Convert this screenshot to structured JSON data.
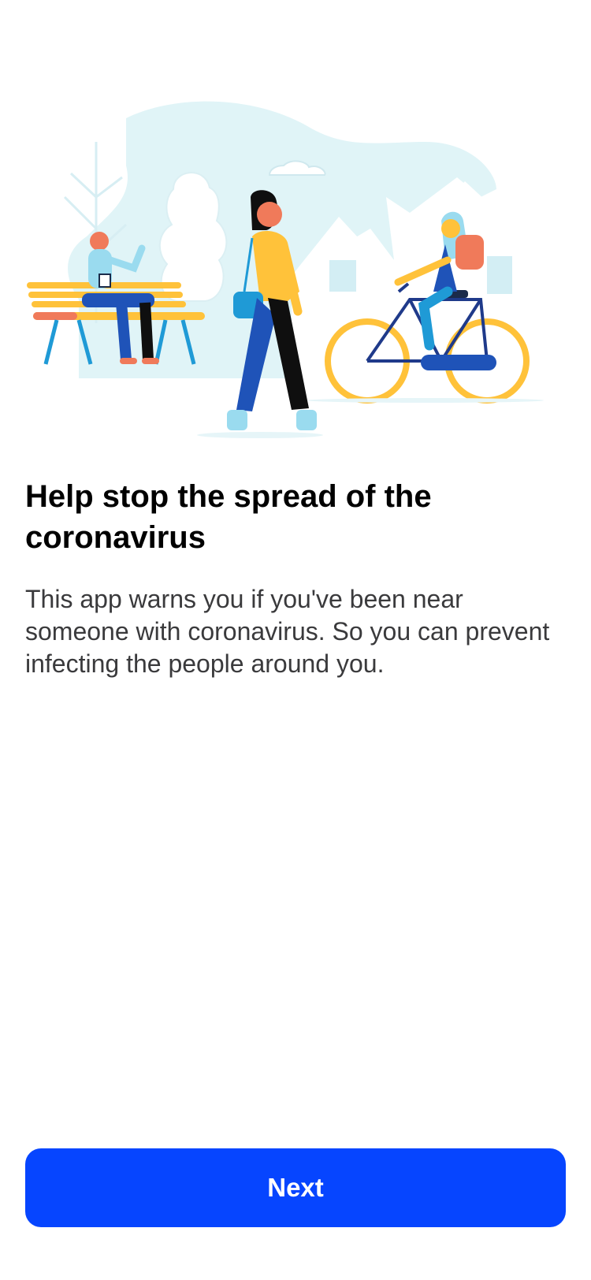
{
  "onboarding": {
    "title": "Help stop the spread of the coronavirus",
    "body": "This app warns you if you've been near someone with coronavirus. So you can prevent infecting the people around you.",
    "next_label": "Next"
  },
  "colors": {
    "accent": "#0645ff",
    "title": "#000000",
    "body": "#3a3a3c",
    "illustration_bg": "#e0f4f7"
  }
}
